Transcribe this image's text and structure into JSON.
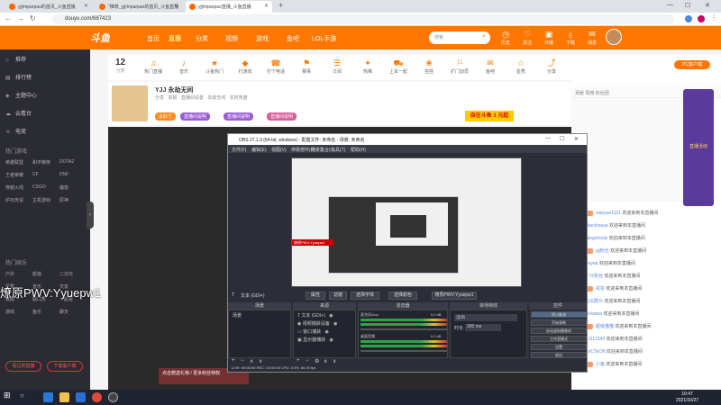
{
  "browser": {
    "tabs": [
      {
        "label": "yjj/mparpao的首页_斗鱼直播"
      },
      {
        "label": "\"推荐_yjj/mparpao的首页_斗鱼直播"
      },
      {
        "label": "yjj/mparpao直播_斗鱼直播"
      }
    ],
    "url": "douyu.com/687423"
  },
  "header": {
    "logo": "斗鱼",
    "nav": [
      "首页",
      "直播",
      "分类",
      "视频",
      "游戏",
      "鱼吧",
      "LOL手游"
    ],
    "search_placeholder": "搜索",
    "icons": [
      {
        "label": "历史"
      },
      {
        "label": "关注"
      },
      {
        "label": "开播"
      },
      {
        "label": "下载"
      },
      {
        "label": "消息"
      }
    ]
  },
  "leftnav": {
    "items": [
      {
        "label": "推荐",
        "icon": "home-icon"
      },
      {
        "label": "排行榜",
        "icon": "rank-icon"
      },
      {
        "label": "主题中心",
        "icon": "theme-icon"
      },
      {
        "label": "云看台",
        "icon": "cloud-icon"
      },
      {
        "label": "电竞",
        "icon": "esports-icon"
      }
    ],
    "section1": "热门游戏",
    "section2": "热门娱乐",
    "grid": [
      "英雄联盟",
      "和平精英",
      "DOTA2",
      "王者荣耀",
      "CF",
      "DNF",
      "穿越火线",
      "CSGO",
      "魔兽",
      "炉石传说",
      "主机游戏",
      "原神",
      "户外",
      "颜值",
      "二次元",
      "星秀",
      "音乐",
      "交友",
      "舞蹈",
      "脱口秀",
      "一起看",
      "游戏",
      "鱼乐",
      "聊天"
    ],
    "btn_left": "看过的直播",
    "btn_right": "下载客户端"
  },
  "category": {
    "count": "12",
    "count_label": "分类",
    "items": [
      "热门直播",
      "音乐",
      "斗鱼热门",
      "打游戏",
      "打个电话",
      "赛事",
      "订阅",
      "热推",
      "上车一起",
      "捏捏",
      "扩门动员",
      "鱼吧",
      "星秀",
      "分享"
    ]
  },
  "room": {
    "title": "YJJ 永劫无间",
    "subtitle": "分享 · 举报 · 直播间设置 · 永劫无间 · 实时热度",
    "tags": [
      "太好了",
      "直播间说明",
      "直播间说明",
      "直播间说明"
    ],
    "ad_badge": "自在斗鱼 1 元起"
  },
  "overlay_text": "燎原PWV:Yyuepw1",
  "gift_text": "点击赠送礼物 / 更多粉丝特权",
  "chat": {
    "header": "贡献 周榜 粉丝团",
    "pc_client": "PC客户端",
    "side_ad": "直播活动",
    "lines": [
      {
        "user": "xiaoyue1101",
        "msg": "欢迎来到本直播间"
      },
      {
        "user": "ulanshouya",
        "msg": "欢迎来到本直播间"
      },
      {
        "user": "Tangshouly",
        "msg": "欢迎来到本直播间"
      },
      {
        "user": "yjj粉丝",
        "msg": "欢迎来到本直播间"
      },
      {
        "user": "wuyaa",
        "msg": "欢迎来到本直播间"
      },
      {
        "user": "一只粉丝",
        "msg": "欢迎来到本直播间"
      },
      {
        "user": "花花",
        "msg": "欢迎来到本直播间"
      },
      {
        "user": "吃瓜群众",
        "msg": "欢迎来到本直播间"
      },
      {
        "user": "Vivianna",
        "msg": "欢迎来到本直播间"
      },
      {
        "user": "超级猫猫",
        "msg": "欢迎来到本直播间"
      },
      {
        "user": "YJJ12345",
        "msg": "欢迎来到本直播间"
      },
      {
        "user": "CoCToCN",
        "msg": "欢迎来到本直播间"
      },
      {
        "user": "小鱼",
        "msg": "欢迎来到本直播间"
      }
    ]
  },
  "obs": {
    "title": "OBS 27.1.3 (64-bit, windows) - 配置文件: 未命名 - 场景: 未命名",
    "menu": [
      "文件(F)",
      "编辑(E)",
      "视图(V)",
      "停靠部件(D)",
      "场景集合(S)",
      "工具(T)",
      "帮助(H)"
    ],
    "red_source": "燎原PWV:Yyuepw1",
    "src_toolbar": {
      "label": "文本 (GDI+)",
      "props": "属性",
      "filters": "滤镜",
      "select_font": "选择字体",
      "select_color": "选择颜色",
      "value": "燎原PWV:Yyuepw1"
    },
    "docks": {
      "scenes": "场景",
      "sources": "来源",
      "mixer": "混音器",
      "transitions": "转场特效",
      "controls": "控件"
    },
    "scene_item": "场景",
    "sources": [
      "文本 (GDI+)",
      "视频捕获设备",
      "窗口捕获",
      "显示器捕获"
    ],
    "mixer": [
      {
        "name": "麦克风/Aux",
        "db": "0.0 dB"
      },
      {
        "name": "桌面音频",
        "db": "0.0 dB"
      }
    ],
    "transition": {
      "type": "淡出",
      "duration_label": "时长",
      "duration": "300 ms"
    },
    "controls": [
      "停止推流",
      "开始录制",
      "启动虚拟摄像机",
      "工作室模式",
      "设置",
      "退出"
    ],
    "status": "LIVE: 00:00:00    REC: 00:00:00    CPU: 5.0%, 60.00 fps"
  },
  "taskbar": {
    "time": "10:47",
    "date": "2021/10/27"
  }
}
